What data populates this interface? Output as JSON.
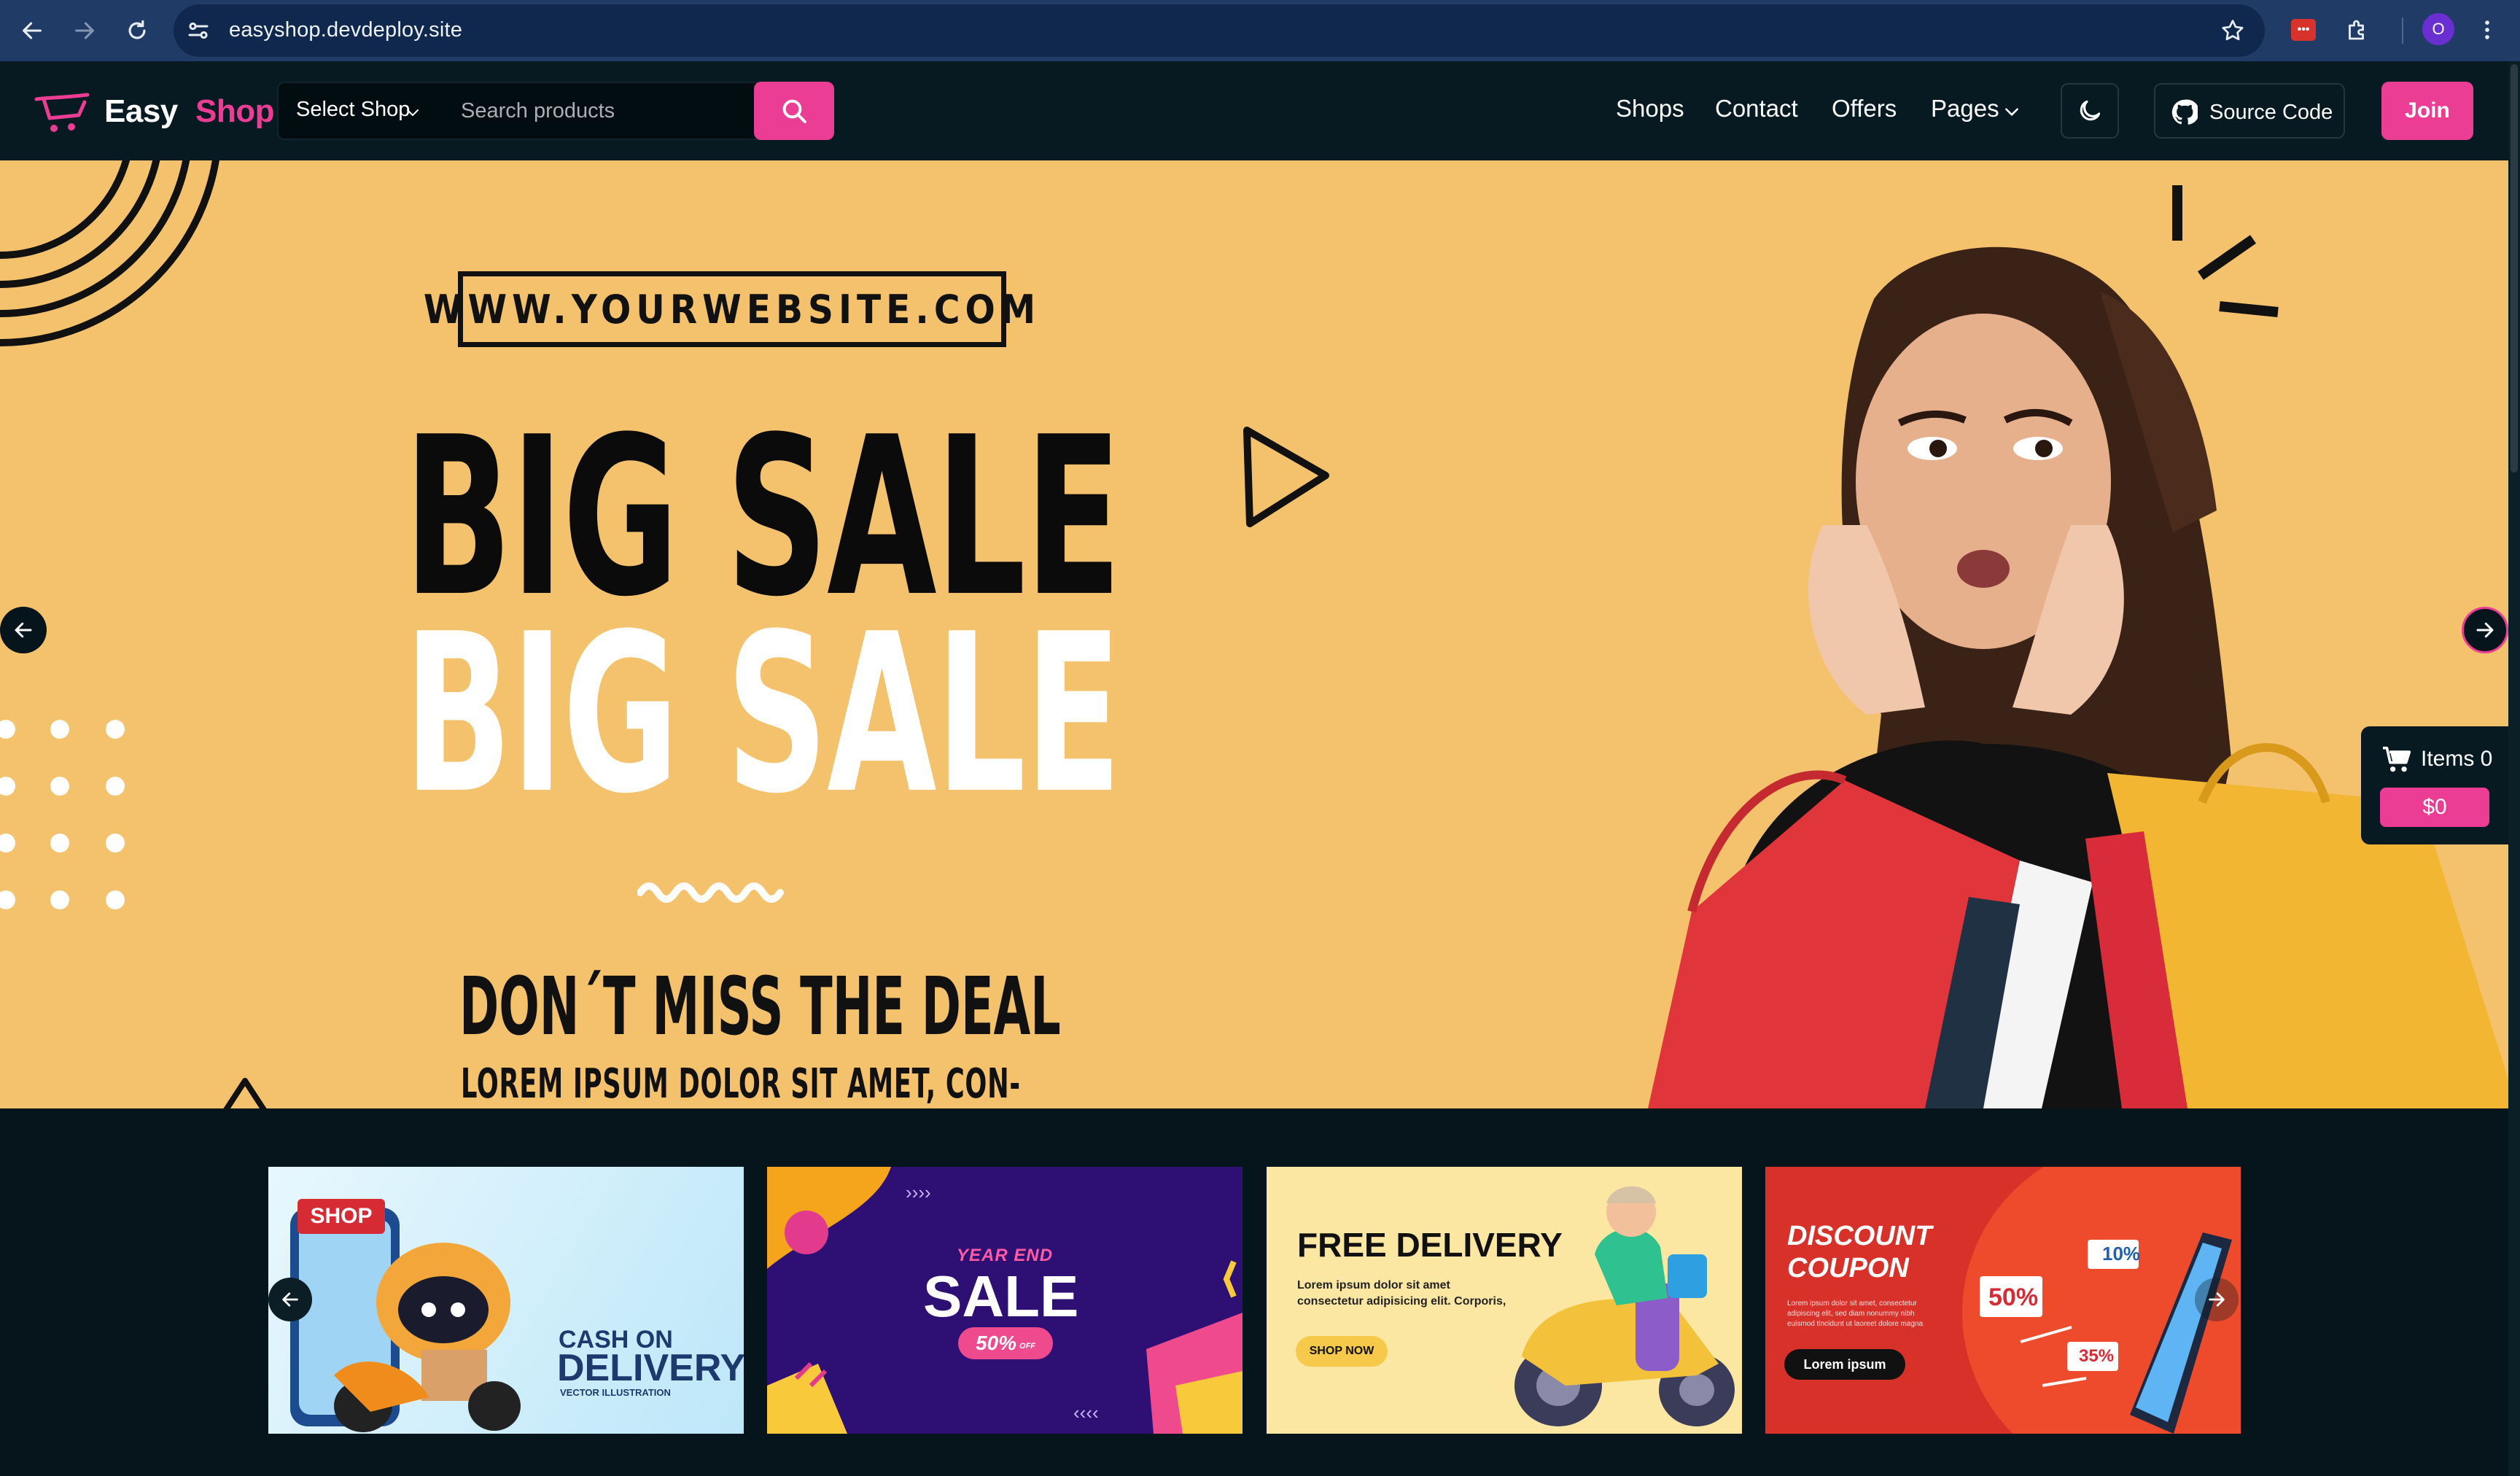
{
  "browser": {
    "url": "easyshop.devdeploy.site",
    "profile_initial": "O"
  },
  "header": {
    "logo_part1": "Easy",
    "logo_part2": "Shop",
    "select_shop_label": "Select Shop",
    "search_placeholder": "Search products",
    "nav": [
      "Shops",
      "Contact",
      "Offers",
      "Pages"
    ],
    "source_code_label": "Source Code",
    "join_label": "Join"
  },
  "hero": {
    "website": "WWW.YOURWEBSITE.COM",
    "headline_1": "BIG SALE",
    "headline_2": "BIG SALE",
    "deal_heading": "DON´T MISS THE DEAL",
    "deal_sub": "LOREM IPSUM DOLOR SIT AMET, CON-"
  },
  "cart": {
    "items_label": "Items 0",
    "total": "$0"
  },
  "promos": {
    "cod": {
      "badge": "SHOP",
      "line1": "CASH ON",
      "line2": "DELIVERY",
      "line3": "VECTOR ILLUSTRATION"
    },
    "sale": {
      "eyebrow": "YEAR END",
      "title": "SALE",
      "badge": "50%",
      "badge_suffix": "OFF"
    },
    "delivery": {
      "title": "FREE DELIVERY",
      "line1": "Lorem ipsum dolor sit amet",
      "line2": "consectetur adipisicing elit. Corporis,",
      "cta": "SHOP NOW"
    },
    "coupon": {
      "title1": "DISCOUNT",
      "title2": "COUPON",
      "body1": "Lorem ipsum dolor sit amet, consectetur",
      "body2": "adipiscing elit, sed diam nonummy nibh",
      "body3": "euismod tincidunt ut laoreet dolore magna",
      "cta": "Lorem ipsum",
      "tag1": "10%",
      "tag2": "50%",
      "tag3": "35%"
    }
  },
  "colors": {
    "accent": "#ec3d95",
    "header_bg": "#071a22",
    "hero_bg": "#f4c26c",
    "browser_chrome": "#1f3b66"
  }
}
